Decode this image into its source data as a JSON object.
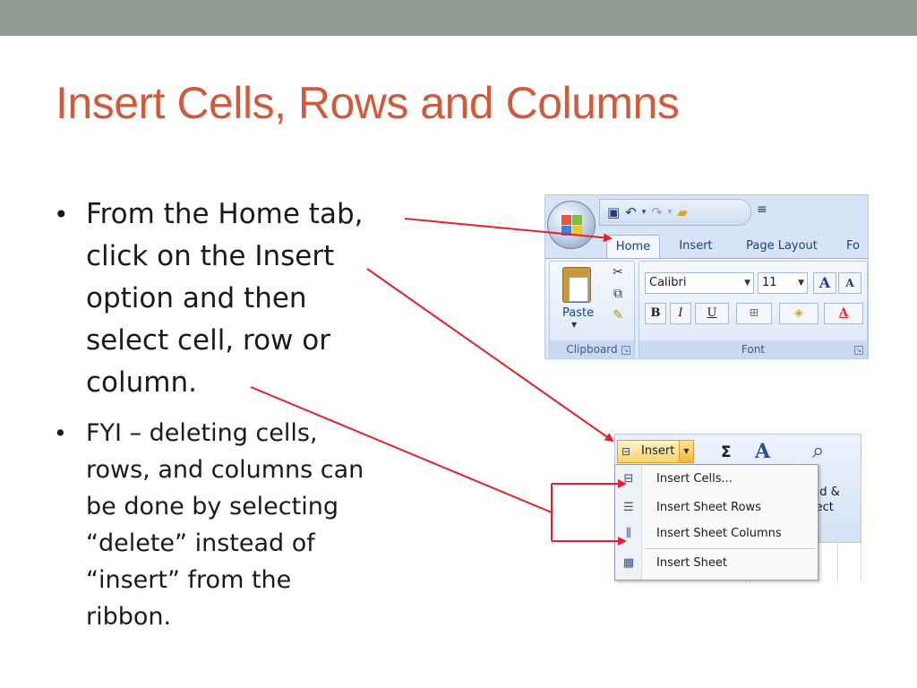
{
  "slide": {
    "title": "Insert Cells, Rows and Columns",
    "bullets": [
      {
        "lines": [
          "From the Home tab,",
          "click on the Insert",
          "option and then",
          "select cell, row or",
          "column."
        ]
      },
      {
        "lines": [
          "FYI – deleting cells,",
          "rows, and columns can",
          "be done by selecting",
          "“delete” instead of",
          "“insert” from the",
          "ribbon."
        ]
      }
    ]
  },
  "ribbon": {
    "tabs": [
      "Home",
      "Insert",
      "Page Layout",
      "Fo"
    ],
    "active_tab": "Home",
    "clipboard": {
      "paste_label": "Paste",
      "group_label": "Clipboard"
    },
    "font": {
      "font_name": "Calibri",
      "font_size": "11",
      "group_label": "Font",
      "bold": "B",
      "italic": "I",
      "underline": "U",
      "grow": "A",
      "shrink": "A"
    },
    "qat_more": "≡"
  },
  "insert_panel": {
    "button_label": "Insert",
    "sigma": "Σ",
    "find_label_1": "nd &",
    "find_label_2": "lect",
    "menu_items": [
      "Insert Cells...",
      "Insert Sheet Rows",
      "Insert Sheet Columns",
      "Insert Sheet"
    ]
  },
  "colors": {
    "title": "#d15a3c",
    "top_bar": "#8e9c94",
    "arrow": "#e5202a",
    "ribbon_text": "#15428b"
  },
  "icons": [
    "office-button-icon",
    "save-icon",
    "undo-icon",
    "redo-icon",
    "open-folder-icon",
    "paste-icon",
    "cut-icon",
    "copy-icon",
    "format-painter-icon",
    "insert-cells-icon",
    "insert-rows-icon",
    "insert-columns-icon",
    "insert-sheet-icon",
    "autosum-icon",
    "sort-filter-icon",
    "find-select-icon"
  ]
}
